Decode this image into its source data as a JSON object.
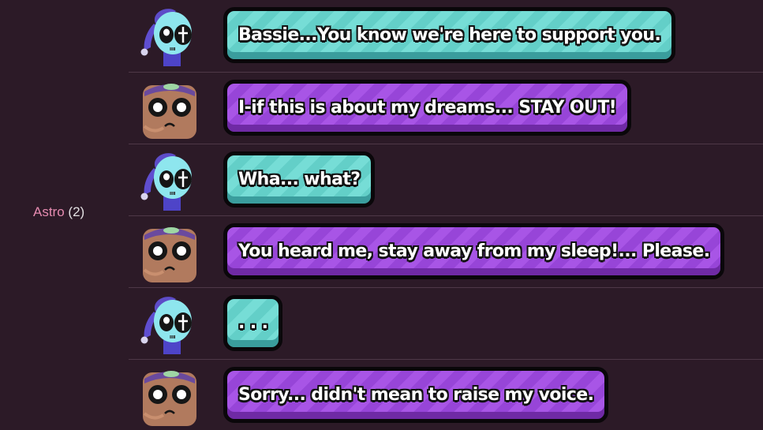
{
  "speaker": {
    "name": "Astro",
    "count": "(2)"
  },
  "messages": [
    {
      "avatar": "blue-ghost-avatar",
      "bubble_color": "#6fd8d1",
      "text": "Bassie...You know we're here to support you."
    },
    {
      "avatar": "brown-sleepy-avatar",
      "bubble_color": "#a14fe0",
      "text": "I-if this is about my dreams... STAY OUT!"
    },
    {
      "avatar": "blue-ghost-avatar",
      "bubble_color": "#6fd8d1",
      "text": "Wha... what?"
    },
    {
      "avatar": "brown-sleepy-avatar",
      "bubble_color": "#a14fe0",
      "text": "You heard me, stay away from my sleep!... Please."
    },
    {
      "avatar": "blue-ghost-avatar",
      "bubble_color": "#6fd8d1",
      "text": ". . ."
    },
    {
      "avatar": "brown-sleepy-avatar",
      "bubble_color": "#a14fe0",
      "text": "Sorry... didn't mean to raise my voice."
    }
  ]
}
